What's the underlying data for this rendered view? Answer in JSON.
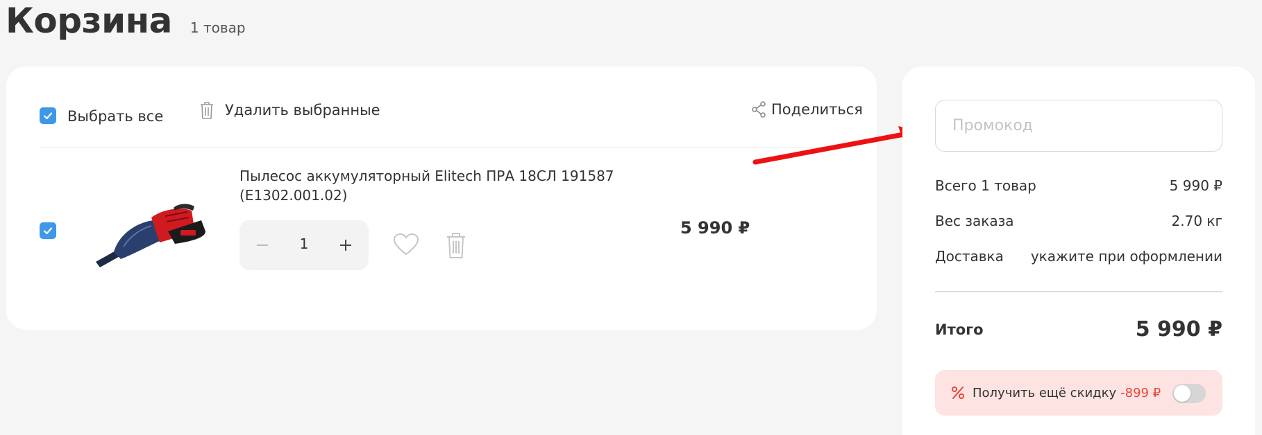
{
  "header": {
    "title": "Корзина",
    "count": "1 товар"
  },
  "toolbar": {
    "select_all": "Выбрать все",
    "delete_selected": "Удалить выбранные",
    "share": "Поделиться"
  },
  "item": {
    "name": "Пылесос аккумуляторный Elitech ПРА 18СЛ 191587 (E1302.001.02)",
    "quantity": "1",
    "price": "5 990 ₽",
    "checked": true
  },
  "summary": {
    "promo_placeholder": "Промокод",
    "rows": [
      {
        "label": "Всего 1 товар",
        "value": "5 990 ₽"
      },
      {
        "label": "Вес заказа",
        "value": "2.70 кг"
      },
      {
        "label": "Доставка",
        "value": "укажите при оформлении"
      }
    ],
    "total_label": "Итого",
    "total_value": "5 990 ₽",
    "discount_text": "Получить ещё скидку",
    "discount_amount": "-899 ₽",
    "discount_toggle_on": false
  },
  "colors": {
    "accent_blue": "#3e97e8",
    "discount_red": "#e8433a",
    "discount_bg": "#fde3e2",
    "annotation_arrow": "#ee1111"
  },
  "icons": {
    "checkbox": "check-icon",
    "delete": "trash-icon",
    "share": "share-icon",
    "favorite": "heart-icon",
    "minus": "minus-icon",
    "plus": "plus-icon",
    "discount": "percent-icon"
  }
}
